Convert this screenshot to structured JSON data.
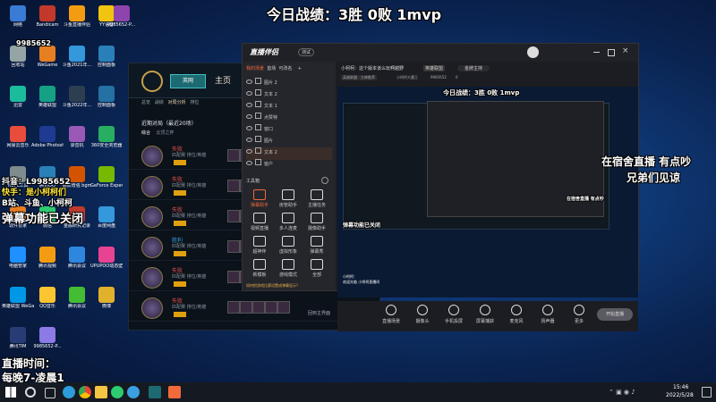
{
  "desktop": {
    "icons": [
      {
        "label": "网络",
        "color": "#3a7bd5"
      },
      {
        "label": "Bandicam",
        "color": "#c0392b"
      },
      {
        "label": "斗鱼直播伴侣",
        "color": "#f39c12"
      },
      {
        "label": "YY语音",
        "color": "#f1c40f"
      },
      {
        "label": "9985652-P...",
        "color": "#8e44ad"
      },
      {
        "label": "回收站",
        "color": "#95a5a6"
      },
      {
        "label": "WeGame",
        "color": "#e67e22"
      },
      {
        "label": "斗鱼2021年...",
        "color": "#3498db"
      },
      {
        "label": "控制面板",
        "color": "#2980b9"
      },
      {
        "label": "迅雷",
        "color": "#1abc9c"
      },
      {
        "label": "英雄联盟",
        "color": "#16a085"
      },
      {
        "label": "斗鱼2022年...",
        "color": "#2c3e50"
      },
      {
        "label": "控制面板",
        "color": "#2471a3"
      },
      {
        "label": "网易云音乐",
        "color": "#e74c3c"
      },
      {
        "label": "Adobe Photosh...",
        "color": "#1f3a93"
      },
      {
        "label": "录音机",
        "color": "#9b59b6"
      },
      {
        "label": "360安全浏览器",
        "color": "#27ae60"
      },
      {
        "label": "ROFL工具",
        "color": "#7f8c8d"
      },
      {
        "label": "腾讯QQ",
        "color": "#2980b9"
      },
      {
        "label": "画质增强 bgm",
        "color": "#d35400"
      },
      {
        "label": "GeForce Experience",
        "color": "#76b900"
      },
      {
        "label": "软件管家",
        "color": "#e67e22"
      },
      {
        "label": "微信",
        "color": "#2ecc71"
      },
      {
        "label": "金融研究记录",
        "color": "#c0392b"
      },
      {
        "label": "百度网盘",
        "color": "#3498db"
      },
      {
        "label": "电脑管家",
        "color": "#1e90ff"
      },
      {
        "label": "腾讯视频",
        "color": "#f39c12"
      },
      {
        "label": "腾讯会议",
        "color": "#2e86de"
      },
      {
        "label": "UPUPOO动态壁纸",
        "color": "#e84393"
      },
      {
        "label": "英雄联盟 WeGame版",
        "color": "#0097e6"
      },
      {
        "label": "QQ音乐",
        "color": "#fbc531"
      },
      {
        "label": "腾讯会议",
        "color": "#44bd32"
      },
      {
        "label": "微博",
        "color": "#e1b12c"
      },
      {
        "label": "腾讯TIM",
        "color": "#273c75"
      },
      {
        "label": "9985652-P...",
        "color": "#8c7ae6"
      }
    ],
    "overlay": {
      "title": "今日战绩：3胜 0败 1mvp",
      "douyin": "抖音：L9985652",
      "kuaishou": "快手：是小柯柯们",
      "bzhan": "B站、斗鱼、小柯柯",
      "danmu_closed": "弹幕功能已关闭",
      "stream_time_label": "直播时间：",
      "stream_time": "每晚7-凌晨1",
      "dorm_line1": "在宿舍直播 有点吵",
      "dorm_line2": "兄弟们见谅",
      "douyu_id": "9985652"
    }
  },
  "lol_client": {
    "nav": [
      "主页",
      "英网",
      "对局分析",
      "排位"
    ],
    "tabs": [
      "总览",
      "战绩",
      "对局",
      "英雄"
    ],
    "section_title": "近期对局（最近20场）",
    "filter_tabs": [
      "综合",
      "云顶之弈"
    ],
    "matches": [
      {
        "result": "失败",
        "color": "#e05050",
        "mode": "匹配赛 排位/英雄"
      },
      {
        "result": "失败",
        "color": "#e05050",
        "mode": "匹配赛 排位/英雄"
      },
      {
        "result": "失败",
        "color": "#e05050",
        "mode": "匹配赛 排位/英雄"
      },
      {
        "result": "胜利",
        "color": "#3aa0e0",
        "mode": "匹配赛 排位/英雄"
      },
      {
        "result": "失败",
        "color": "#e05050",
        "mode": "匹配赛 排位/英雄"
      },
      {
        "result": "失败",
        "color": "#e05050",
        "mode": "匹配赛 排位/英雄"
      }
    ],
    "footer": "回到主界面"
  },
  "stream_app": {
    "logo": "直播伴侣",
    "badge": "测试",
    "side_tabs": [
      "我的场景",
      "首场",
      "可改名",
      "+"
    ],
    "sources": [
      "图片 2",
      "文本 2",
      "文本 1",
      "点赞特",
      "窗口",
      "图片",
      "文本 2",
      "窗户"
    ],
    "tools_title": "工具箱",
    "tools": [
      "弹幕助手",
      "房管助手",
      "主播任务",
      "视频直播",
      "多人连麦",
      "摄像助手",
      "超神伴",
      "虚拟形象",
      "弹幕秀",
      "新模板",
      "游戏模式",
      "全部"
    ],
    "notice": "如何把游戏比赛设置成弹幕显示？",
    "room_title": "小柯柯：这个版本该么玩啊越野",
    "room_tag": "英雄联盟",
    "room_link": "金牌主持",
    "room_sub": [
      "英雄联盟 · 大神推荐",
      "小柯柯大魔王",
      "9985652"
    ],
    "likes": "0",
    "bottom_buttons": [
      "直播场景",
      "摄像头",
      "手机投屏",
      "屏幕捕获",
      "麦克风",
      "扬声器",
      "更多"
    ],
    "start_button": "开始直播",
    "chat_name": "小柯柯：",
    "chat_text": "欢迎光临 小柯柯直播间"
  },
  "taskbar": {
    "time": "15:46",
    "date": "2022/5/28"
  }
}
